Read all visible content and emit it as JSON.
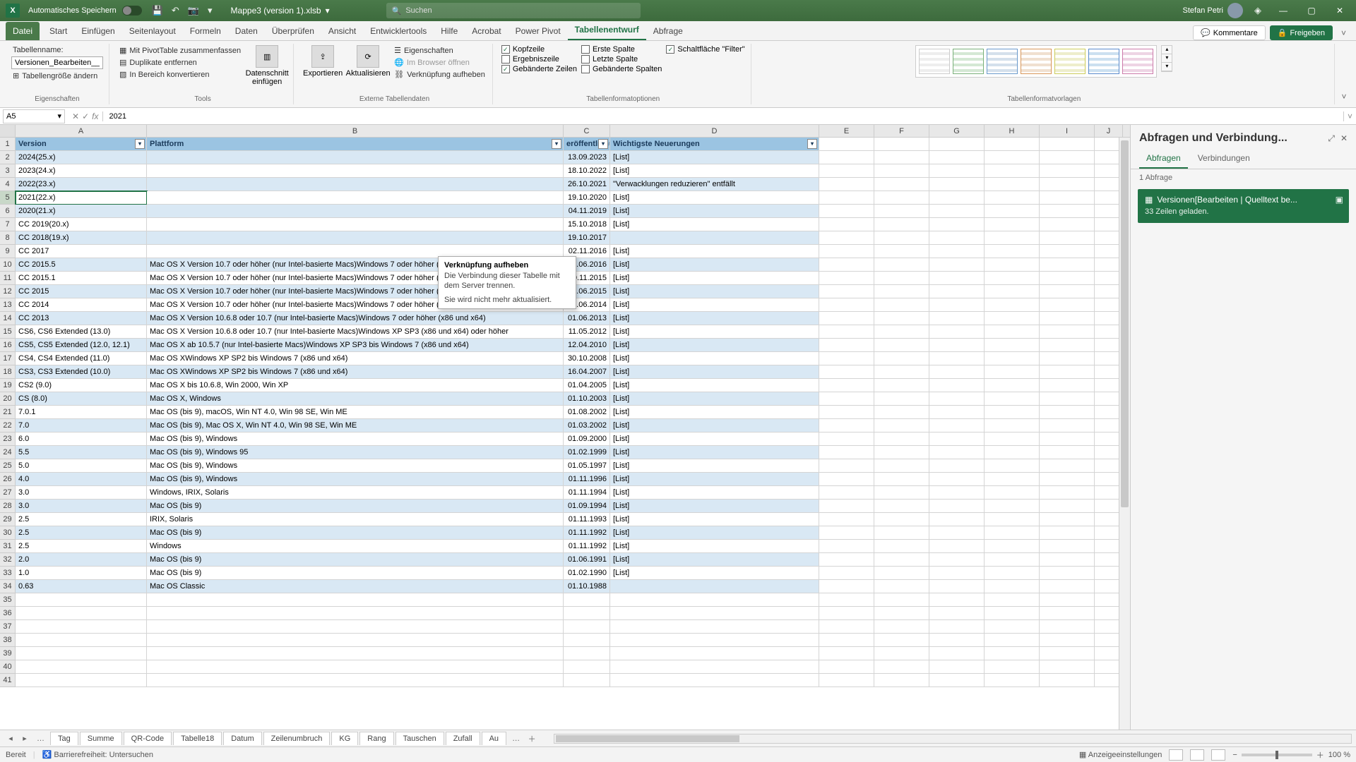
{
  "titlebar": {
    "autosave": "Automatisches Speichern",
    "filename": "Mappe3 (version 1).xlsb",
    "search_placeholder": "Suchen",
    "user": "Stefan Petri"
  },
  "tabs": {
    "file": "Datei",
    "items": [
      "Start",
      "Einfügen",
      "Seitenlayout",
      "Formeln",
      "Daten",
      "Überprüfen",
      "Ansicht",
      "Entwicklertools",
      "Hilfe",
      "Acrobat",
      "Power Pivot",
      "Tabellenentwurf",
      "Abfrage"
    ],
    "active": "Tabellenentwurf",
    "comments": "Kommentare",
    "share": "Freigeben"
  },
  "ribbon": {
    "g1": {
      "label_name": "Tabellenname:",
      "value": "Versionen_Bearbeiten__Qu",
      "resize": "Tabellengröße ändern",
      "group": "Eigenschaften"
    },
    "g2": {
      "a": "Mit PivotTable zusammenfassen",
      "b": "Duplikate entfernen",
      "c": "In Bereich konvertieren",
      "slicer": "Datenschnitt einfügen",
      "group": "Tools"
    },
    "g3": {
      "export": "Exportieren",
      "refresh": "Aktualisieren",
      "prop": "Eigenschaften",
      "browser": "Im Browser öffnen",
      "unlink": "Verknüpfung aufheben",
      "group": "Externe Tabellendaten"
    },
    "g4": {
      "a": "Kopfzeile",
      "b": "Ergebniszeile",
      "c": "Gebänderte Zeilen",
      "d": "Erste Spalte",
      "e": "Letzte Spalte",
      "f": "Gebänderte Spalten",
      "g": "Schaltfläche \"Filter\"",
      "group": "Tabellenformatoptionen"
    },
    "g5": {
      "group": "Tabellenformatvorlagen"
    }
  },
  "formula": {
    "namebox": "A5",
    "value": "2021"
  },
  "headers": {
    "A": "Version",
    "B": "Plattform",
    "C": "eröffentlichung",
    "D": "Wichtigste Neuerungen"
  },
  "cols": [
    "A",
    "B",
    "C",
    "D",
    "E",
    "F",
    "G",
    "H",
    "I",
    "J"
  ],
  "rows": [
    {
      "n": 2,
      "v": "2024(25.x)",
      "p": "",
      "c": "13.09.2023",
      "d": "[List]"
    },
    {
      "n": 3,
      "v": "2023(24.x)",
      "p": "",
      "c": "18.10.2022",
      "d": "[List]"
    },
    {
      "n": 4,
      "v": "2022(23.x)",
      "p": "",
      "c": "26.10.2021",
      "d": "\"Verwacklungen reduzieren\" entfällt"
    },
    {
      "n": 5,
      "v": "2021(22.x)",
      "p": "",
      "c": "19.10.2020",
      "d": "[List]"
    },
    {
      "n": 6,
      "v": "2020(21.x)",
      "p": "",
      "c": "04.11.2019",
      "d": "[List]"
    },
    {
      "n": 7,
      "v": "CC 2019(20.x)",
      "p": "",
      "c": "15.10.2018",
      "d": "[List]"
    },
    {
      "n": 8,
      "v": "CC 2018(19.x)",
      "p": "",
      "c": "19.10.2017",
      "d": ""
    },
    {
      "n": 9,
      "v": "CC 2017",
      "p": "",
      "c": "02.11.2016",
      "d": "[List]"
    },
    {
      "n": 10,
      "v": "CC 2015.5",
      "p": "Mac OS X Version 10.7 oder höher (nur Intel-basierte Macs)Windows 7 oder höher (x86 und x64)",
      "c": "20.06.2016",
      "d": "[List]"
    },
    {
      "n": 11,
      "v": "CC 2015.1",
      "p": "Mac OS X Version 10.7 oder höher (nur Intel-basierte Macs)Windows 7 oder höher (x86 und x64)",
      "c": "30.11.2015",
      "d": "[List]"
    },
    {
      "n": 12,
      "v": "CC 2015",
      "p": "Mac OS X Version 10.7 oder höher (nur Intel-basierte Macs)Windows 7 oder höher (x86 und x64)",
      "c": "15.06.2015",
      "d": "[List]"
    },
    {
      "n": 13,
      "v": "CC 2014",
      "p": "Mac OS X Version 10.7 oder höher (nur Intel-basierte Macs)Windows 7 oder höher (x86 und x64)",
      "c": "01.06.2014",
      "d": "[List]"
    },
    {
      "n": 14,
      "v": "CC 2013",
      "p": "Mac OS X Version 10.6.8 oder 10.7 (nur Intel-basierte Macs)Windows 7 oder höher (x86 und x64)",
      "c": "01.06.2013",
      "d": "[List]"
    },
    {
      "n": 15,
      "v": "CS6, CS6 Extended (13.0)",
      "p": "Mac OS X Version 10.6.8 oder 10.7 (nur Intel-basierte Macs)Windows XP SP3 (x86 und x64) oder höher",
      "c": "11.05.2012",
      "d": "[List]"
    },
    {
      "n": 16,
      "v": "CS5, CS5 Extended (12.0, 12.1)",
      "p": "Mac OS X ab 10.5.7 (nur Intel-basierte Macs)Windows XP SP3 bis Windows 7 (x86 und x64)",
      "c": "12.04.2010",
      "d": "[List]"
    },
    {
      "n": 17,
      "v": "CS4, CS4 Extended (11.0)",
      "p": "Mac OS XWindows XP SP2 bis Windows 7 (x86 und x64)",
      "c": "30.10.2008",
      "d": "[List]"
    },
    {
      "n": 18,
      "v": "CS3, CS3 Extended (10.0)",
      "p": "Mac OS XWindows XP SP2 bis Windows 7 (x86 und x64)",
      "c": "16.04.2007",
      "d": "[List]"
    },
    {
      "n": 19,
      "v": "CS2 (9.0)",
      "p": "Mac OS X bis 10.6.8, Win 2000, Win XP",
      "c": "01.04.2005",
      "d": "[List]"
    },
    {
      "n": 20,
      "v": "CS (8.0)",
      "p": "Mac OS X, Windows",
      "c": "01.10.2003",
      "d": "[List]"
    },
    {
      "n": 21,
      "v": "7.0.1",
      "p": "Mac OS (bis 9), macOS, Win NT 4.0, Win 98 SE, Win ME",
      "c": "01.08.2002",
      "d": "[List]"
    },
    {
      "n": 22,
      "v": "7.0",
      "p": "Mac OS (bis 9), Mac OS X, Win NT 4.0, Win 98 SE, Win ME",
      "c": "01.03.2002",
      "d": "[List]"
    },
    {
      "n": 23,
      "v": "6.0",
      "p": "Mac OS (bis 9), Windows",
      "c": "01.09.2000",
      "d": "[List]"
    },
    {
      "n": 24,
      "v": "5.5",
      "p": "Mac OS (bis 9), Windows 95",
      "c": "01.02.1999",
      "d": "[List]"
    },
    {
      "n": 25,
      "v": "5.0",
      "p": "Mac OS (bis 9), Windows",
      "c": "01.05.1997",
      "d": "[List]"
    },
    {
      "n": 26,
      "v": "4.0",
      "p": "Mac OS (bis 9), Windows",
      "c": "01.11.1996",
      "d": "[List]"
    },
    {
      "n": 27,
      "v": "3.0",
      "p": "Windows, IRIX, Solaris",
      "c": "01.11.1994",
      "d": "[List]"
    },
    {
      "n": 28,
      "v": "3.0",
      "p": "Mac OS (bis 9)",
      "c": "01.09.1994",
      "d": "[List]"
    },
    {
      "n": 29,
      "v": "2.5",
      "p": "IRIX, Solaris",
      "c": "01.11.1993",
      "d": "[List]"
    },
    {
      "n": 30,
      "v": "2.5",
      "p": "Mac OS (bis 9)",
      "c": "01.11.1992",
      "d": "[List]"
    },
    {
      "n": 31,
      "v": "2.5",
      "p": "Windows",
      "c": "01.11.1992",
      "d": "[List]"
    },
    {
      "n": 32,
      "v": "2.0",
      "p": "Mac OS (bis 9)",
      "c": "01.06.1991",
      "d": "[List]"
    },
    {
      "n": 33,
      "v": "1.0",
      "p": "Mac OS (bis 9)",
      "c": "01.02.1990",
      "d": "[List]"
    },
    {
      "n": 34,
      "v": "0.63",
      "p": "Mac OS Classic",
      "c": "01.10.1988",
      "d": ""
    }
  ],
  "empty_rows": [
    35,
    36,
    37,
    38,
    39,
    40,
    41
  ],
  "tooltip": {
    "title": "Verknüpfung aufheben",
    "body": "Die Verbindung dieser Tabelle mit dem Server trennen.",
    "foot": "Sie wird nicht mehr aktualisiert."
  },
  "pane": {
    "title": "Abfragen und Verbindung...",
    "tab1": "Abfragen",
    "tab2": "Verbindungen",
    "count": "1 Abfrage",
    "qname": "Versionen[Bearbeiten | Quelltext be...",
    "qsub": "33 Zeilen geladen."
  },
  "sheets": [
    "Tag",
    "Summe",
    "QR-Code",
    "Tabelle18",
    "Datum",
    "Zeilenumbruch",
    "KG",
    "Rang",
    "Tauschen",
    "Zufall",
    "Au"
  ],
  "status": {
    "ready": "Bereit",
    "access": "Barrierefreiheit: Untersuchen",
    "disp": "Anzeigeeinstellungen",
    "zoom": "100 %"
  }
}
